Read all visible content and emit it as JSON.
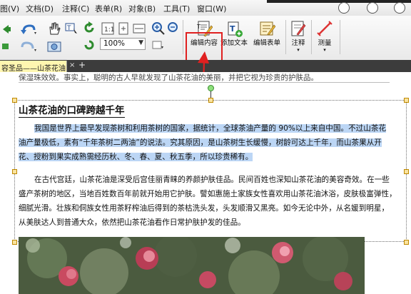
{
  "menu": {
    "items": [
      "图(V)",
      "文档(D)",
      "注释(C)",
      "表单(R)",
      "对象(B)",
      "工具(T)",
      "窗口(W)"
    ]
  },
  "toolbar": {
    "zoom_value": "100%",
    "edit_content_label": "编辑内容",
    "add_text_label": "添加文本",
    "edit_form_label": "编辑表单",
    "annotate_label": "注释",
    "measure_label": "测量"
  },
  "tabs": {
    "active_label": "容圣品——山茶花油"
  },
  "document": {
    "prev_line": "保湿珠效效。事实上，聪明的古人早就发现了山茶花油的美丽，并把它视为珍贵的护肤品。",
    "heading": "山茶花油的口碑跨越千年",
    "para1_lines": [
      "我国是世界上最早发现茶树和利用茶树的国家，据统计，全球茶油产量的 90%以上来自中国。不过山茶花",
      "油产量极低，素有“千年茶树二两油”的说法。究其原因，是山茶树生长缓慢，树龄可达上千年，而山茶果从开",
      "花、授粉到果实成熟需经历秋、冬、春、夏、秋五季，所以珍贵稀有。"
    ],
    "para2_lines": [
      "在古代宫廷，山茶花油是深受后宫佳丽青睐的养颜护肤佳品。民间百姓也深知山茶花油的美容奇效。在一些",
      "盛产茶树的地区，当地百姓数百年前就开始用它护肤。譬如惠施土家族女性喜欢用山茶花油沐浴，皮肤极富弹性，",
      "细腻光滑。壮族和侗族女性用茶籽榨油后得到的茶枯洗头发，头发顺滑又黑亮。如今无论中外，从名媛到明星，",
      "从美肤达人到普通大众，依然把山茶花油看作日常护肤护发的佳品。"
    ]
  },
  "colors": {
    "highlight_box": "#e02020",
    "selection": "#bcd6f5",
    "tab_active": "#fff6b0"
  }
}
